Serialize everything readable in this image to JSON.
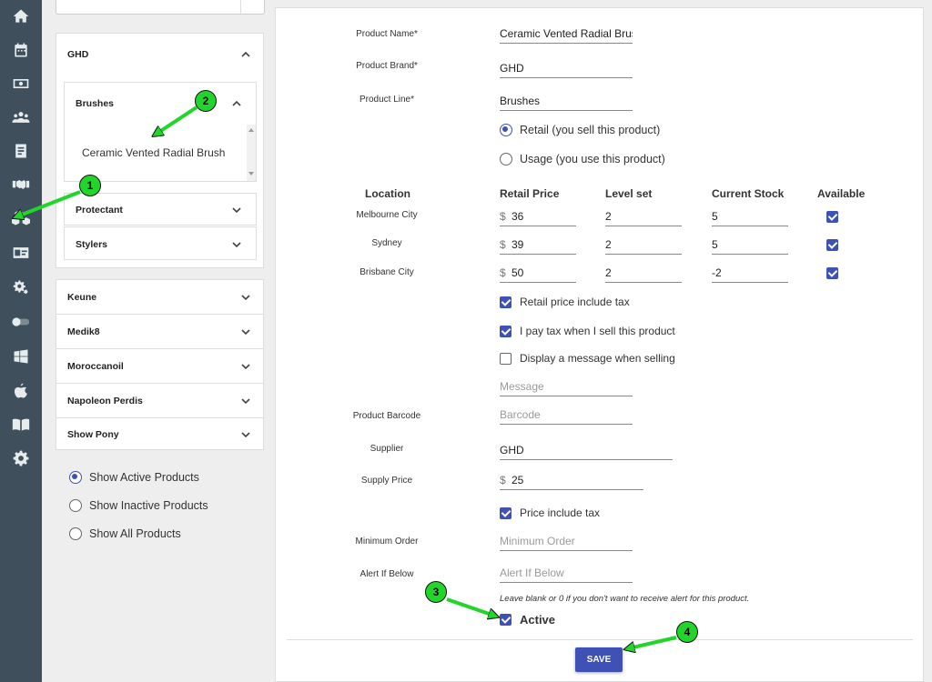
{
  "rail": {
    "icons": [
      "home-icon",
      "calendar-icon",
      "cash-icon",
      "users-icon",
      "ledger-icon",
      "handshake-icon",
      "products-icon",
      "id-card-icon",
      "settings-icon",
      "toggle-icon",
      "windows-icon",
      "apple-icon",
      "book-icon",
      "gear-icon"
    ]
  },
  "brands": {
    "ghd": {
      "name": "GHD",
      "lines": {
        "brushes": {
          "name": "Brushes",
          "product": "Ceramic Vented Radial Brush"
        },
        "protectant": {
          "name": "Protectant"
        },
        "stylers": {
          "name": "Stylers"
        }
      }
    },
    "others": [
      "Keune",
      "Medik8",
      "Moroccanoil",
      "Napoleon Perdis",
      "Show Pony"
    ]
  },
  "filters": {
    "active": "Show Active Products",
    "inactive": "Show Inactive Products",
    "all": "Show All Products",
    "selected": "active"
  },
  "form": {
    "product_name_label": "Product Name*",
    "product_name": "Ceramic Vented Radial Brush",
    "product_brand_label": "Product Brand*",
    "product_brand": "GHD",
    "product_line_label": "Product Line*",
    "product_line": "Brushes",
    "retail_option": "Retail (you sell this product)",
    "usage_option": "Usage (you use this product)",
    "table": {
      "headers": {
        "location": "Location",
        "retail_price": "Retail Price",
        "level_set": "Level set",
        "current_stock": "Current Stock",
        "available": "Available"
      },
      "currency": "$",
      "rows": [
        {
          "location": "Melbourne City",
          "retail_price": "36",
          "level_set": "2",
          "current_stock": "5",
          "available": true
        },
        {
          "location": "Sydney",
          "retail_price": "39",
          "level_set": "2",
          "current_stock": "5",
          "available": true
        },
        {
          "location": "Brisbane City",
          "retail_price": "50",
          "level_set": "2",
          "current_stock": "-2",
          "available": true
        }
      ]
    },
    "retail_tax_label": "Retail price include tax",
    "pay_tax_label": "I pay tax when I sell this product",
    "display_message_label": "Display a message when selling",
    "message_placeholder": "Message",
    "barcode_label": "Product Barcode",
    "barcode_placeholder": "Barcode",
    "supplier_label": "Supplier",
    "supplier": "GHD",
    "supply_price_label": "Supply Price",
    "supply_price": "25",
    "price_include_tax_label": "Price include tax",
    "minimum_order_label": "Minimum Order",
    "minimum_order_placeholder": "Minimum Order",
    "alert_label": "Alert If Below",
    "alert_placeholder": "Alert If Below",
    "alert_note": "Leave blank or 0 if you don't want to receive alert for this product.",
    "active_label": "Active",
    "save_label": "SAVE"
  },
  "callouts": [
    "1",
    "2",
    "3",
    "4"
  ],
  "colors": {
    "accent": "#3f51b5",
    "callout": "#22d52a",
    "rail": "#3f505c"
  }
}
